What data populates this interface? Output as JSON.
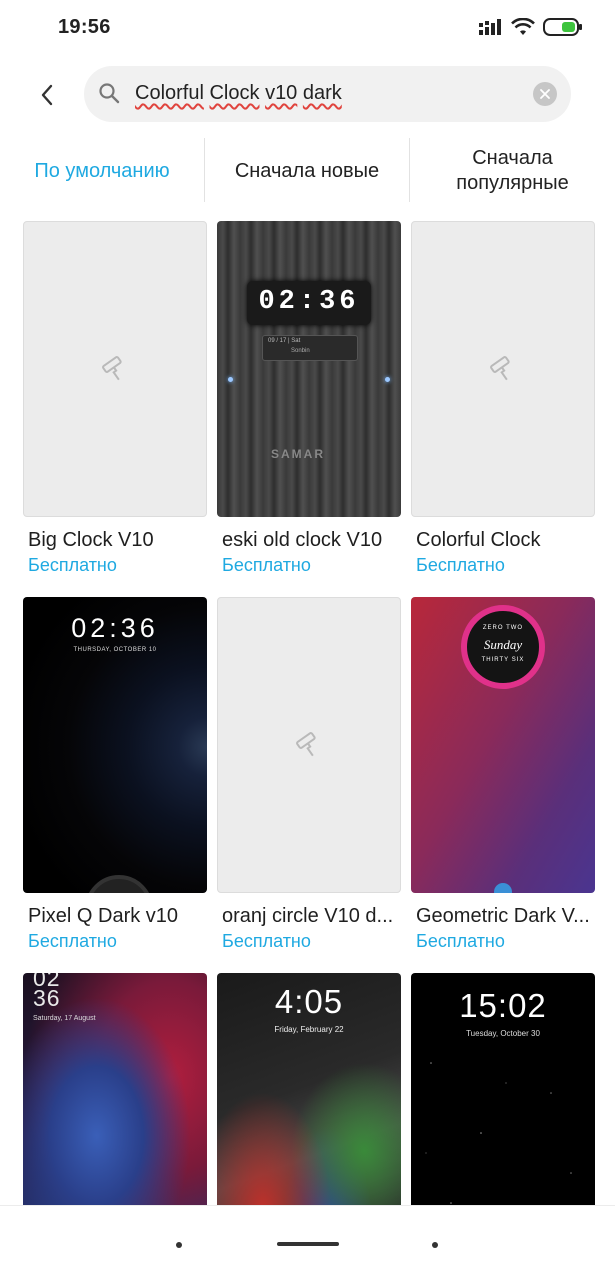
{
  "status_bar": {
    "time": "19:56"
  },
  "search": {
    "query_words": [
      "Colorful",
      "Clock",
      "v10",
      "dark"
    ]
  },
  "sort_tabs": [
    {
      "label": "По умолчанию",
      "active": true
    },
    {
      "label": "Сначала новые",
      "active": false
    },
    {
      "label": "Сначала популярные",
      "active": false
    }
  ],
  "themes": [
    {
      "name": "Big Clock V10",
      "price": "Бесплатно",
      "preview": "placeholder"
    },
    {
      "name": "eski old clock V10",
      "price": "Бесплатно",
      "preview": "wood",
      "clock": "02:36",
      "date": "09 / 17 | Sat",
      "sub": "Sonbin",
      "watermark": "SAMAR"
    },
    {
      "name": "Colorful Clock",
      "price": "Бесплатно",
      "preview": "placeholder"
    },
    {
      "name": "Pixel Q Dark v10",
      "price": "Бесплатно",
      "preview": "pixel",
      "clock": "02:36",
      "date": "THURSDAY, OCTOBER 10"
    },
    {
      "name": "oranj circle V10 d...",
      "price": "Бесплатно",
      "preview": "placeholder"
    },
    {
      "name": "Geometric Dark V...",
      "price": "Бесплатно",
      "preview": "geometric",
      "top": "ZERO TWO",
      "middle": "Sunday",
      "bottom": "THIRTY SIX"
    },
    {
      "name": "",
      "price": "",
      "preview": "smoke",
      "clock_top": "02",
      "clock_bottom": "36",
      "date": "Saturday, 17 August"
    },
    {
      "name": "",
      "price": "",
      "preview": "marble",
      "clock": "4:05",
      "date": "Friday, February 22"
    },
    {
      "name": "",
      "price": "",
      "preview": "stars",
      "clock": "15:02",
      "date": "Tuesday, October 30"
    }
  ],
  "colors": {
    "accent": "#1fa9e1",
    "spellcheck": "#e0443e"
  }
}
